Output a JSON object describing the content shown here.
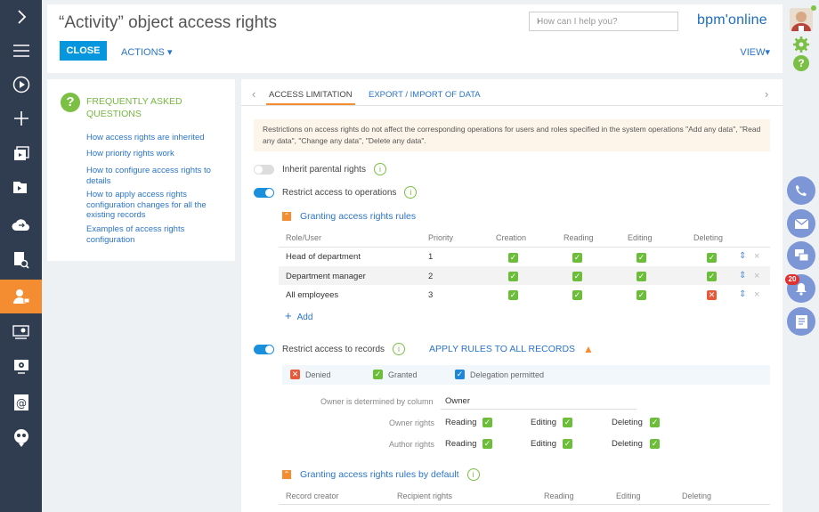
{
  "header": {
    "title": "“Activity” object access rights",
    "close_label": "CLOSE",
    "actions_label": "ACTIONS ▾",
    "search_placeholder": "How can I help you?",
    "logo": "bpm'online",
    "view_label": "VIEW▾"
  },
  "faq": {
    "title": "FREQUENTLY ASKED QUESTIONS",
    "links": [
      "How access rights are inherited",
      "How priority rights work",
      "How to configure access rights to details",
      "How to apply access rights configuration changes for all the existing records",
      "Examples of access rights configuration"
    ]
  },
  "tabs": [
    {
      "label": "ACCESS LIMITATION",
      "active": true
    },
    {
      "label": "EXPORT / IMPORT OF DATA",
      "active": false
    }
  ],
  "notice": "Restrictions on access rights do not affect the corresponding operations for users and roles specified in the system operations \"Add any data\", \"Read any data\", \"Change any data\", \"Delete any data\".",
  "toggles": {
    "inherit": {
      "label": "Inherit parental rights",
      "on": false
    },
    "operations": {
      "label": "Restrict access to operations",
      "on": true
    },
    "records": {
      "label": "Restrict access to records",
      "on": true
    }
  },
  "operations_section": {
    "title": "Granting access rights rules",
    "columns": [
      "Role/User",
      "Priority",
      "Creation",
      "Reading",
      "Editing",
      "Deleting"
    ],
    "rows": [
      {
        "role": "Head of department",
        "priority": "1",
        "creation": "granted",
        "reading": "granted",
        "editing": "granted",
        "deleting": "granted"
      },
      {
        "role": "Department manager",
        "priority": "2",
        "creation": "granted",
        "reading": "granted",
        "editing": "granted",
        "deleting": "granted"
      },
      {
        "role": "All employees",
        "priority": "3",
        "creation": "granted",
        "reading": "granted",
        "editing": "granted",
        "deleting": "denied"
      }
    ],
    "add_label": "Add"
  },
  "records_section": {
    "apply_label": "APPLY RULES TO ALL RECORDS",
    "legend": [
      "Denied",
      "Granted",
      "Delegation permitted"
    ],
    "owner_label": "Owner is determined by column",
    "owner_value": "Owner",
    "owner_rights_label": "Owner rights",
    "author_rights_label": "Author rights",
    "rights": [
      "Reading",
      "Editing",
      "Deleting"
    ]
  },
  "default_section": {
    "title": "Granting access rights rules by default",
    "columns": [
      "Record creator",
      "Recipient rights",
      "Reading",
      "Editing",
      "Deleting"
    ]
  },
  "rail": {
    "notification_count": "20"
  },
  "colors": {
    "sidebar": "#303c4f",
    "accent": "#f48d31",
    "primary": "#0596de",
    "link": "#2b74c9",
    "green": "#6cbd3a",
    "red": "#e65a3b"
  }
}
